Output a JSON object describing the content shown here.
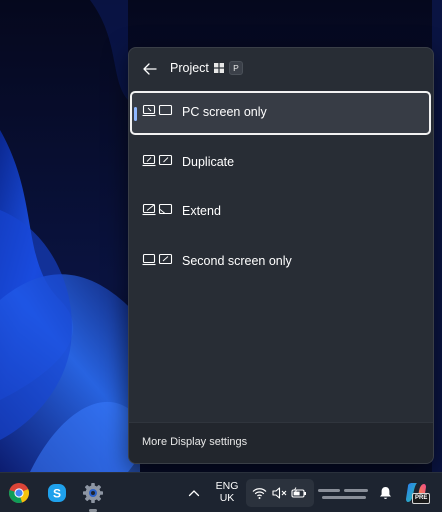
{
  "flyout": {
    "title": "Project",
    "shortcut_key": "P",
    "back_icon": "back-arrow-icon",
    "options": [
      {
        "label": "PC screen only",
        "icon": "pc-screen-only-icon",
        "selected": true
      },
      {
        "label": "Duplicate",
        "icon": "duplicate-icon",
        "selected": false
      },
      {
        "label": "Extend",
        "icon": "extend-icon",
        "selected": false
      },
      {
        "label": "Second screen only",
        "icon": "second-screen-only-icon",
        "selected": false
      }
    ],
    "footer_link": "More Display settings"
  },
  "taskbar": {
    "apps": [
      {
        "name": "chrome-icon"
      },
      {
        "name": "skype-icon"
      },
      {
        "name": "settings-icon"
      }
    ],
    "language_line1": "ENG",
    "language_line2": "UK",
    "tray_icons": [
      "wifi-icon",
      "volume-muted-icon",
      "battery-icon"
    ],
    "copilot_badge": "PRE"
  },
  "colors": {
    "flyout_bg": "#282d35",
    "selected_bg": "#373c45",
    "accent": "#8fb7ff",
    "taskbar_bg": "#1d2430"
  }
}
